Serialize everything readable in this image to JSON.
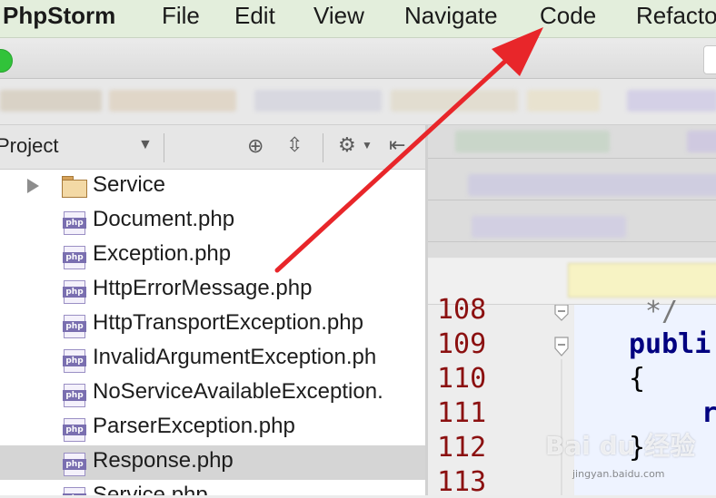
{
  "menubar": {
    "app_name": "PhpStorm",
    "items": [
      "File",
      "Edit",
      "View",
      "Navigate",
      "Code",
      "Refacto"
    ]
  },
  "project_panel": {
    "title": "Project",
    "icons": [
      "dropdown-icon",
      "locate-icon",
      "collapse-icon",
      "gear-icon",
      "hide-icon"
    ]
  },
  "tree": {
    "items": [
      {
        "label": "Service",
        "type": "folder"
      },
      {
        "label": "Document.php",
        "type": "php"
      },
      {
        "label": "Exception.php",
        "type": "php"
      },
      {
        "label": "HttpErrorMessage.php",
        "type": "php"
      },
      {
        "label": "HttpTransportException.php",
        "type": "php"
      },
      {
        "label": "InvalidArgumentException.ph",
        "type": "php"
      },
      {
        "label": "NoServiceAvailableException.",
        "type": "php"
      },
      {
        "label": "ParserException.php",
        "type": "php"
      },
      {
        "label": "Response.php",
        "type": "php",
        "selected": true
      },
      {
        "label": "Service.php",
        "type": "php"
      }
    ],
    "php_icon_text": "php"
  },
  "editor": {
    "line_numbers": [
      "108",
      "109",
      "110",
      "111",
      "112",
      "113"
    ],
    "code_lines": [
      "*/",
      "publi",
      "{",
      "r",
      "}"
    ]
  },
  "watermark": {
    "text": "Bai du 经验",
    "sub": "jingyan.baidu.com"
  },
  "colors": {
    "menubar_bg": "#e3eedc",
    "line_number": "#8b1010",
    "keyword": "#000080",
    "annotation_arrow": "#e8262a",
    "selected_row": "#d5d5d5"
  }
}
